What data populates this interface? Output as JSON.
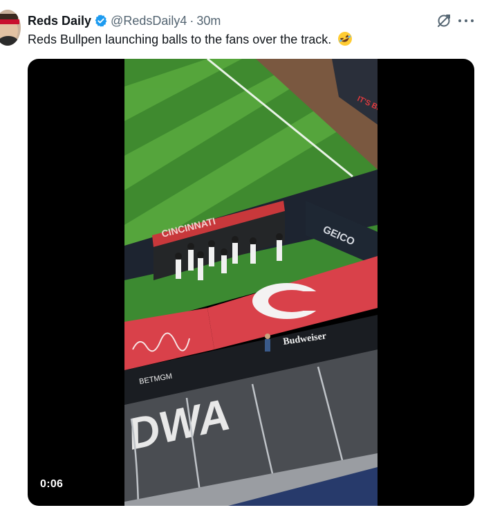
{
  "tweet": {
    "author_name": "Reds Daily",
    "handle": "@RedsDaily4",
    "separator": "·",
    "time": "30m",
    "text": "Reds Bullpen launching balls to the fans over the track.",
    "emoji": "rolling-on-floor-laughing-emoji"
  },
  "icons": {
    "verified": "verified-badge-icon",
    "grok": "grok-icon",
    "more": "more-icon"
  },
  "video": {
    "timestamp": "0:06",
    "scene_text": {
      "dugout_banner": "CINCINNATI",
      "geico": "GEICO",
      "budweiser": "Budweiser",
      "betmgm": "BETMGM",
      "track_letters": "DWA",
      "top_sign": "IT'S BRI"
    }
  },
  "colors": {
    "verified_blue": "#1d9bf0",
    "text_primary": "#0f1419",
    "text_secondary": "#536471",
    "reds_red": "#e03a3e"
  }
}
